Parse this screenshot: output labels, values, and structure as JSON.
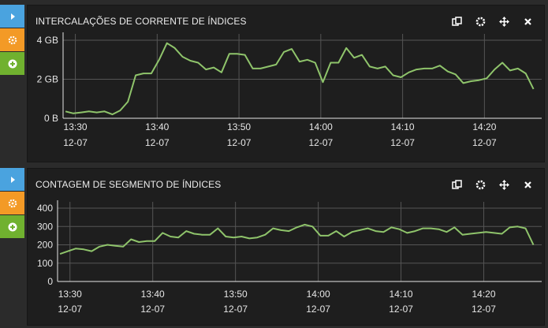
{
  "colors": {
    "line": "#8fc46b",
    "grid": "#555555",
    "axis": "#e6e6e6",
    "blue": "#4aa3df",
    "orange": "#f39a26",
    "green": "#70b12f"
  },
  "panels": [
    {
      "title": "INTERCALAÇÕES DE CORRENTE DE ÍNDICES",
      "tools": [
        "copy-icon",
        "gear-icon",
        "move-icon",
        "close-icon"
      ],
      "sidebar": [
        "play-icon",
        "settings-icon",
        "add-icon"
      ]
    },
    {
      "title": "CONTAGEM DE SEGMENTO DE ÍNDICES",
      "tools": [
        "copy-icon",
        "gear-icon",
        "move-icon",
        "close-icon"
      ],
      "sidebar": [
        "play-icon",
        "settings-icon",
        "add-icon"
      ]
    }
  ],
  "chart_data": [
    {
      "type": "line",
      "title": "INTERCALAÇÕES DE CORRENTE DE ÍNDICES",
      "y_ticks": [
        "0 B",
        "2 GB",
        "4 GB"
      ],
      "ylim": [
        0,
        4
      ],
      "y_unit": "GB",
      "x_ticks": [
        [
          "13:30",
          "12-07"
        ],
        [
          "13:40",
          "12-07"
        ],
        [
          "13:50",
          "12-07"
        ],
        [
          "14:00",
          "12-07"
        ],
        [
          "14:10",
          "12-07"
        ],
        [
          "14:20",
          "12-07"
        ]
      ],
      "x_tick_minutes": [
        0,
        10,
        20,
        30,
        40,
        50
      ],
      "x_range_minutes": [
        -1.5,
        57
      ],
      "grid": true,
      "x": [
        -1,
        0,
        1,
        2,
        3,
        4,
        5,
        6,
        7,
        8,
        9,
        10,
        11,
        12,
        13,
        14,
        15,
        16,
        17,
        18,
        19,
        20,
        21,
        22,
        23,
        24,
        25,
        26,
        27,
        28,
        29,
        30,
        31,
        32,
        33,
        34,
        35,
        36,
        37,
        38,
        39,
        40,
        41,
        42,
        43,
        44,
        45,
        46,
        47,
        48,
        49,
        50,
        51,
        52,
        53,
        54,
        55,
        56
      ],
      "y": [
        0.35,
        0.25,
        0.3,
        0.35,
        0.3,
        0.35,
        0.2,
        0.4,
        0.85,
        2.2,
        2.3,
        2.3,
        3.0,
        3.85,
        3.6,
        3.15,
        2.95,
        2.85,
        2.5,
        2.6,
        2.35,
        3.3,
        3.3,
        3.25,
        2.55,
        2.55,
        2.65,
        2.75,
        3.4,
        3.55,
        2.9,
        3.0,
        2.85,
        1.85,
        2.85,
        2.85,
        3.6,
        3.1,
        3.25,
        2.65,
        2.55,
        2.65,
        2.2,
        2.1,
        2.35,
        2.5,
        2.55,
        2.55,
        2.7,
        2.4,
        2.25,
        1.8,
        1.9,
        1.95,
        2.05,
        2.5,
        2.85,
        2.45,
        2.55,
        2.3,
        1.5
      ]
    },
    {
      "type": "line",
      "title": "CONTAGEM DE SEGMENTO DE ÍNDICES",
      "y_ticks": [
        "0",
        "100",
        "200",
        "300",
        "400"
      ],
      "ylim": [
        0,
        400
      ],
      "x_ticks": [
        [
          "13:30",
          "12-07"
        ],
        [
          "13:40",
          "12-07"
        ],
        [
          "13:50",
          "12-07"
        ],
        [
          "14:00",
          "12-07"
        ],
        [
          "14:10",
          "12-07"
        ],
        [
          "14:20",
          "12-07"
        ]
      ],
      "x_tick_minutes": [
        0,
        10,
        20,
        30,
        40,
        50
      ],
      "x_range_minutes": [
        -1.5,
        57
      ],
      "grid": true,
      "x": [
        -1,
        0,
        1,
        2,
        3,
        4,
        5,
        6,
        7,
        8,
        9,
        10,
        11,
        12,
        13,
        14,
        15,
        16,
        17,
        18,
        19,
        20,
        21,
        22,
        23,
        24,
        25,
        26,
        27,
        28,
        29,
        30,
        31,
        32,
        33,
        34,
        35,
        36,
        37,
        38,
        39,
        40,
        41,
        42,
        43,
        44,
        45,
        46,
        47,
        48,
        49,
        50,
        51,
        52,
        53,
        54,
        55,
        56
      ],
      "y": [
        150,
        165,
        180,
        175,
        165,
        190,
        200,
        195,
        190,
        230,
        215,
        220,
        220,
        265,
        245,
        240,
        275,
        260,
        255,
        255,
        290,
        245,
        240,
        245,
        235,
        240,
        255,
        290,
        280,
        275,
        295,
        310,
        300,
        250,
        250,
        275,
        245,
        270,
        280,
        290,
        275,
        270,
        295,
        285,
        265,
        275,
        290,
        290,
        285,
        270,
        295,
        255,
        260,
        265,
        270,
        265,
        260,
        295,
        300,
        290,
        200
      ]
    }
  ]
}
